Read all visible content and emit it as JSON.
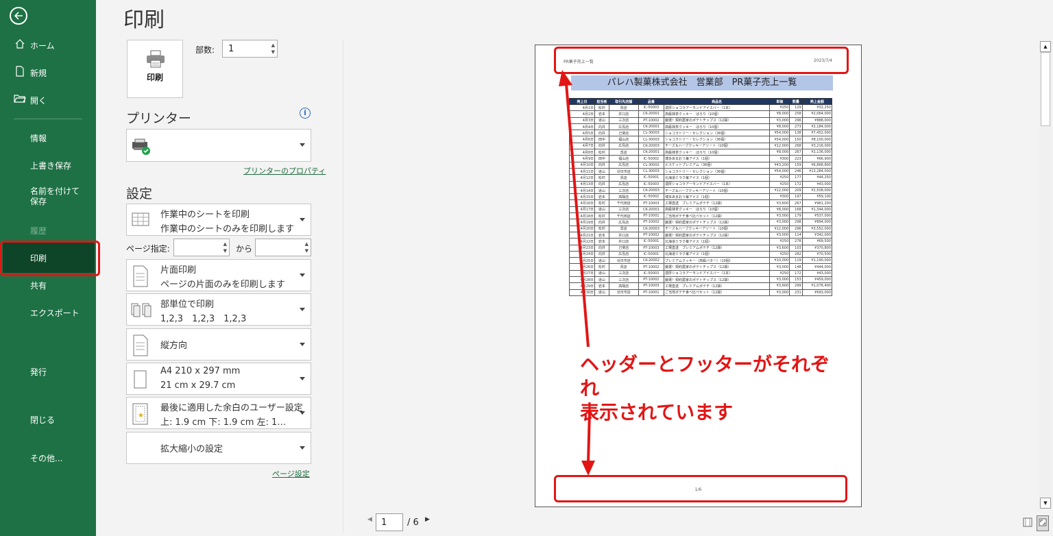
{
  "sidebar": {
    "items": [
      {
        "label": "ホーム",
        "icon": "home-icon"
      },
      {
        "label": "新規",
        "icon": "new-document-icon"
      },
      {
        "label": "開く",
        "icon": "open-folder-icon"
      },
      {
        "label": "情報"
      },
      {
        "label": "上書き保存"
      },
      {
        "label": "名前を付けて保存"
      },
      {
        "label": "履歴"
      },
      {
        "label": "印刷"
      },
      {
        "label": "共有"
      },
      {
        "label": "エクスポート"
      },
      {
        "label": "発行"
      },
      {
        "label": "閉じる"
      },
      {
        "label": "その他..."
      }
    ]
  },
  "page_title": "印刷",
  "print_button": "印刷",
  "copies": {
    "label": "部数:",
    "value": "1"
  },
  "printer": {
    "heading": "プリンター",
    "name": "",
    "properties_link": "プリンターのプロパティ"
  },
  "settings": {
    "heading": "設定",
    "sheet": {
      "title": "作業中のシートを印刷",
      "sub": "作業中のシートのみを印刷します"
    },
    "pages_label": "ページ指定:",
    "pages_from": "",
    "to_label": "から",
    "pages_to": "",
    "sided": {
      "title": "片面印刷",
      "sub": "ページの片面のみを印刷します"
    },
    "collate": {
      "title": "部単位で印刷",
      "sub": "1,2,3　1,2,3　1,2,3"
    },
    "orientation": {
      "title": "縦方向"
    },
    "paper": {
      "title": "A4 210 x 297 mm",
      "sub": "21 cm x 29.7 cm"
    },
    "margins": {
      "title": "最後に適用した余白のユーザー設定",
      "sub": "上: 1.9 cm 下: 1.9 cm 左: 1…"
    },
    "scaling": {
      "title": "拡大縮小の設定"
    },
    "page_setup_link": "ページ設定"
  },
  "preview": {
    "header_left": "PR菓子売上一覧",
    "header_right": "2023/7/4",
    "banner": "パレハ製菓株式会社　営業部　PR菓子売上一覧",
    "columns": [
      "売上日",
      "担当者",
      "取引先店舗",
      "品番",
      "商品名",
      "単価",
      "数量",
      "売上金額"
    ],
    "rows": [
      [
        "4月1日",
        "松村",
        "呉店",
        "IC-50003",
        "濃厚ショコラアーモンドアイスバー（1本）",
        "¥250",
        "129",
        "¥32,250"
      ],
      [
        "4月2日",
        "岩本",
        "井口店",
        "CK-20001",
        "高級抹茶クッキー　ほろり（10個）",
        "¥8,000",
        "258",
        "¥2,064,000"
      ],
      [
        "4月3日",
        "道山",
        "三次店",
        "PT-10002",
        "厳選！契約農家のポテトチップス（12袋）",
        "¥3,000",
        "296",
        "¥888,000"
      ],
      [
        "4月4日",
        "向井",
        "広島店",
        "CK-20001",
        "高級抹茶クッキー　ほろり（10個）",
        "¥8,000",
        "273",
        "¥2,184,000"
      ],
      [
        "4月5日",
        "向井",
        "己斐店",
        "CL-30003",
        "ショコラトリー・セレクション（36個）",
        "¥54,000",
        "138",
        "¥7,452,000"
      ],
      [
        "4月6日",
        "田中",
        "福山店",
        "CL-30003",
        "ショコラトリー・セレクション（36個）",
        "¥54,000",
        "150",
        "¥8,100,000"
      ],
      [
        "4月7日",
        "向井",
        "広島店",
        "CK-20003",
        "チーズ＆ハーブクッキーアソート（10個）",
        "¥12,000",
        "268",
        "¥3,216,000"
      ],
      [
        "4月8日",
        "松村",
        "呉店",
        "CK-20001",
        "高級抹茶クッキー　ほろり（10個）",
        "¥8,000",
        "267",
        "¥2,136,000"
      ],
      [
        "4月9日",
        "田中",
        "福山店",
        "IC-50002",
        "博多あまおう苺アイス（1個）",
        "¥300",
        "223",
        "¥66,900"
      ],
      [
        "4月10日",
        "向井",
        "広島店",
        "CL-30002",
        "ビスケットプレミアム（36個）",
        "¥43,200",
        "159",
        "¥6,868,800"
      ],
      [
        "4月11日",
        "道山",
        "廿日市店",
        "CL-30003",
        "ショコラトリー・セレクション（36個）",
        "¥54,000",
        "246",
        "¥13,284,000"
      ],
      [
        "4月12日",
        "松村",
        "呉店",
        "IC-50001",
        "北海道ミラク苺アイス（1個）",
        "¥250",
        "177",
        "¥44,250"
      ],
      [
        "4月13日",
        "向井",
        "広島店",
        "IC-50003",
        "濃厚ショコラアーモンドアイスバー（1本）",
        "¥250",
        "172",
        "¥43,000"
      ],
      [
        "4月14日",
        "道山",
        "三次店",
        "CK-20003",
        "チーズ＆ハーブクッキーアソート（10個）",
        "¥12,000",
        "209",
        "¥2,508,000"
      ],
      [
        "4月15日",
        "岩本",
        "高陽店",
        "IC-50002",
        "博多あまおう苺アイス（1個）",
        "¥300",
        "197",
        "¥59,100"
      ],
      [
        "4月16日",
        "松村",
        "千代田店",
        "PT-10003",
        "工場直送　プレミアムポテチ（12袋）",
        "¥3,600",
        "267",
        "¥961,200"
      ],
      [
        "4月17日",
        "道山",
        "三次店",
        "CK-20001",
        "高級抹茶クッキー　ほろり（10個）",
        "¥8,000",
        "168",
        "¥1,344,000"
      ],
      [
        "4月18日",
        "松村",
        "千代田店",
        "PT-10001",
        "ご当地ポテチ食べ比べセット（12袋）",
        "¥3,000",
        "179",
        "¥537,000"
      ],
      [
        "4月19日",
        "向井",
        "広島店",
        "PT-10002",
        "厳選！契約農家のポテトチップス（12袋）",
        "¥3,000",
        "298",
        "¥894,000"
      ],
      [
        "4月20日",
        "松村",
        "呉店",
        "CK-20003",
        "チーズ＆ハーブクッキーアソート（10個）",
        "¥12,000",
        "296",
        "¥3,552,000"
      ],
      [
        "4月21日",
        "岩本",
        "井口店",
        "PT-10002",
        "厳選！契約農家のポテトチップス（12袋）",
        "¥3,000",
        "114",
        "¥342,000"
      ],
      [
        "4月22日",
        "岩本",
        "井口店",
        "IC-50001",
        "北海道ミラク苺アイス（1個）",
        "¥250",
        "278",
        "¥69,500"
      ],
      [
        "4月23日",
        "向井",
        "己斐店",
        "PT-10003",
        "工場直送　プレミアムポテチ（12袋）",
        "¥3,600",
        "103",
        "¥370,800"
      ],
      [
        "4月24日",
        "向井",
        "広島店",
        "IC-50001",
        "北海道ミラク苺アイス（1個）",
        "¥250",
        "282",
        "¥70,500"
      ],
      [
        "4月25日",
        "道山",
        "廿日市店",
        "CK-20002",
        "プレミアムクッキー（高級バター）（10個）",
        "¥10,000",
        "119",
        "¥1,190,000"
      ],
      [
        "4月26日",
        "松村",
        "呉店",
        "PT-10002",
        "厳選！契約農家のポテトチップス（12袋）",
        "¥3,000",
        "148",
        "¥444,000"
      ],
      [
        "4月27日",
        "道山",
        "三次店",
        "IC-50003",
        "濃厚ショコラアーモンドアイスバー（1本）",
        "¥250",
        "172",
        "¥43,000"
      ],
      [
        "4月28日",
        "道山",
        "三次店",
        "PT-10002",
        "厳選！契約農家のポテトチップス（12袋）",
        "¥3,000",
        "153",
        "¥459,000"
      ],
      [
        "4月29日",
        "岩本",
        "高陽店",
        "PT-10003",
        "工場直送　プレミアムポテチ（12袋）",
        "¥3,600",
        "299",
        "¥1,076,400"
      ],
      [
        "4月30日",
        "道山",
        "廿日市店",
        "PT-10001",
        "ご当地ポテチ食べ比べセット（12袋）",
        "¥3,000",
        "231",
        "¥693,000"
      ]
    ],
    "footer": "1/6"
  },
  "annotation": {
    "line1": "ヘッダーとフッターがそれぞれ",
    "line2": "表示されています"
  },
  "pager": {
    "current": "1",
    "total": "/ 6"
  },
  "colors": {
    "sidebar": "#1e7145",
    "sidebar_active": "#0e4428",
    "highlight": "#e21515",
    "table_header": "#1f3864",
    "banner": "#b4c6e7"
  }
}
